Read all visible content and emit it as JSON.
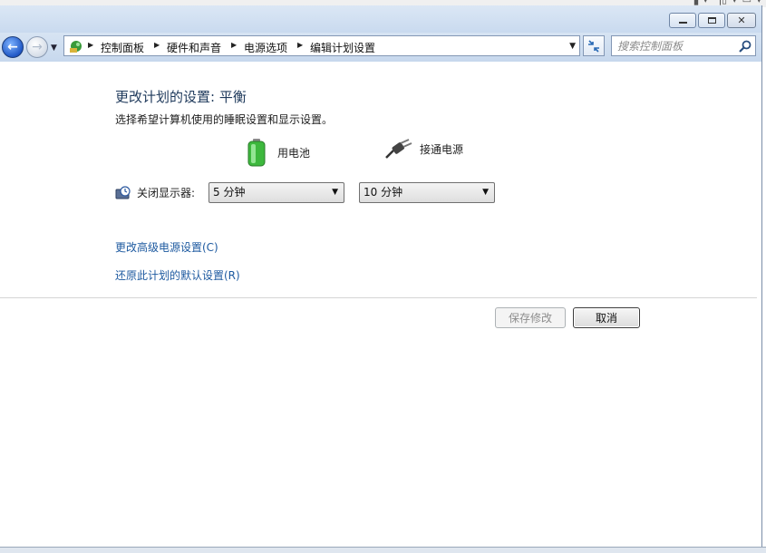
{
  "window": {
    "controls": {
      "minimize": "minimize",
      "maximize": "maximize",
      "close": "close"
    }
  },
  "navigation": {
    "breadcrumbs": [
      "控制面板",
      "硬件和声音",
      "电源选项",
      "编辑计划设置"
    ],
    "search_placeholder": "搜索控制面板"
  },
  "page": {
    "title": "更改计划的设置: 平衡",
    "description": "选择希望计算机使用的睡眠设置和显示设置。",
    "columns": {
      "battery": "用电池",
      "plugged_in": "接通电源"
    },
    "settings": [
      {
        "label": "关闭显示器:",
        "battery_value": "5 分钟",
        "plugged_in_value": "10 分钟"
      }
    ],
    "links": {
      "advanced": "更改高级电源设置(C)",
      "restore": "还原此计划的默认设置(R)"
    },
    "buttons": {
      "save": "保存修改",
      "cancel": "取消"
    }
  },
  "colors": {
    "title": "#1e395b",
    "link": "#1e5aa0",
    "chrome": "#c9daef"
  }
}
